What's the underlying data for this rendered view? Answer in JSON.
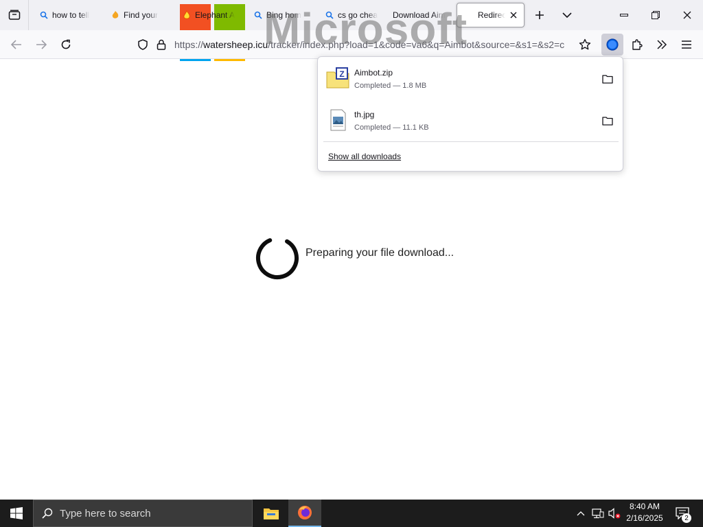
{
  "browser": {
    "tabs": [
      {
        "label": "how to tell",
        "icon": "search-icon"
      },
      {
        "label": "Find your",
        "icon": "bing-flame-icon"
      },
      {
        "label": "Elephant A",
        "icon": "fire-icon"
      },
      {
        "label": "Bing hom",
        "icon": "search-icon"
      },
      {
        "label": "cs go chea",
        "icon": "search-icon"
      },
      {
        "label": "Download Aim",
        "icon": ""
      },
      {
        "label": "Redirect",
        "icon": ""
      }
    ],
    "url": {
      "scheme": "https://",
      "host": "watersheep.icu",
      "path": "/tracker/index.php?load=1&code=va6&q=Aimbot&source=&s1=&s2=c"
    },
    "overlay_text": "Microsoft"
  },
  "downloads": {
    "items": [
      {
        "name": "Aimbot.zip",
        "status": "Completed — 1.8 MB",
        "icon": "zip-archive-icon"
      },
      {
        "name": "th.jpg",
        "status": "Completed — 11.1 KB",
        "icon": "image-file-icon"
      }
    ],
    "show_all": "Show all downloads"
  },
  "page": {
    "message": "Preparing your file download..."
  },
  "taskbar": {
    "search_placeholder": "Type here to search",
    "time": "8:40 AM",
    "date": "2/16/2025",
    "notification_count": "2"
  },
  "colors": {
    "accent": "#0060df",
    "ms_red": "#f25022",
    "ms_green": "#7fba00",
    "ms_blue": "#00a4ef",
    "ms_yellow": "#ffb900"
  }
}
